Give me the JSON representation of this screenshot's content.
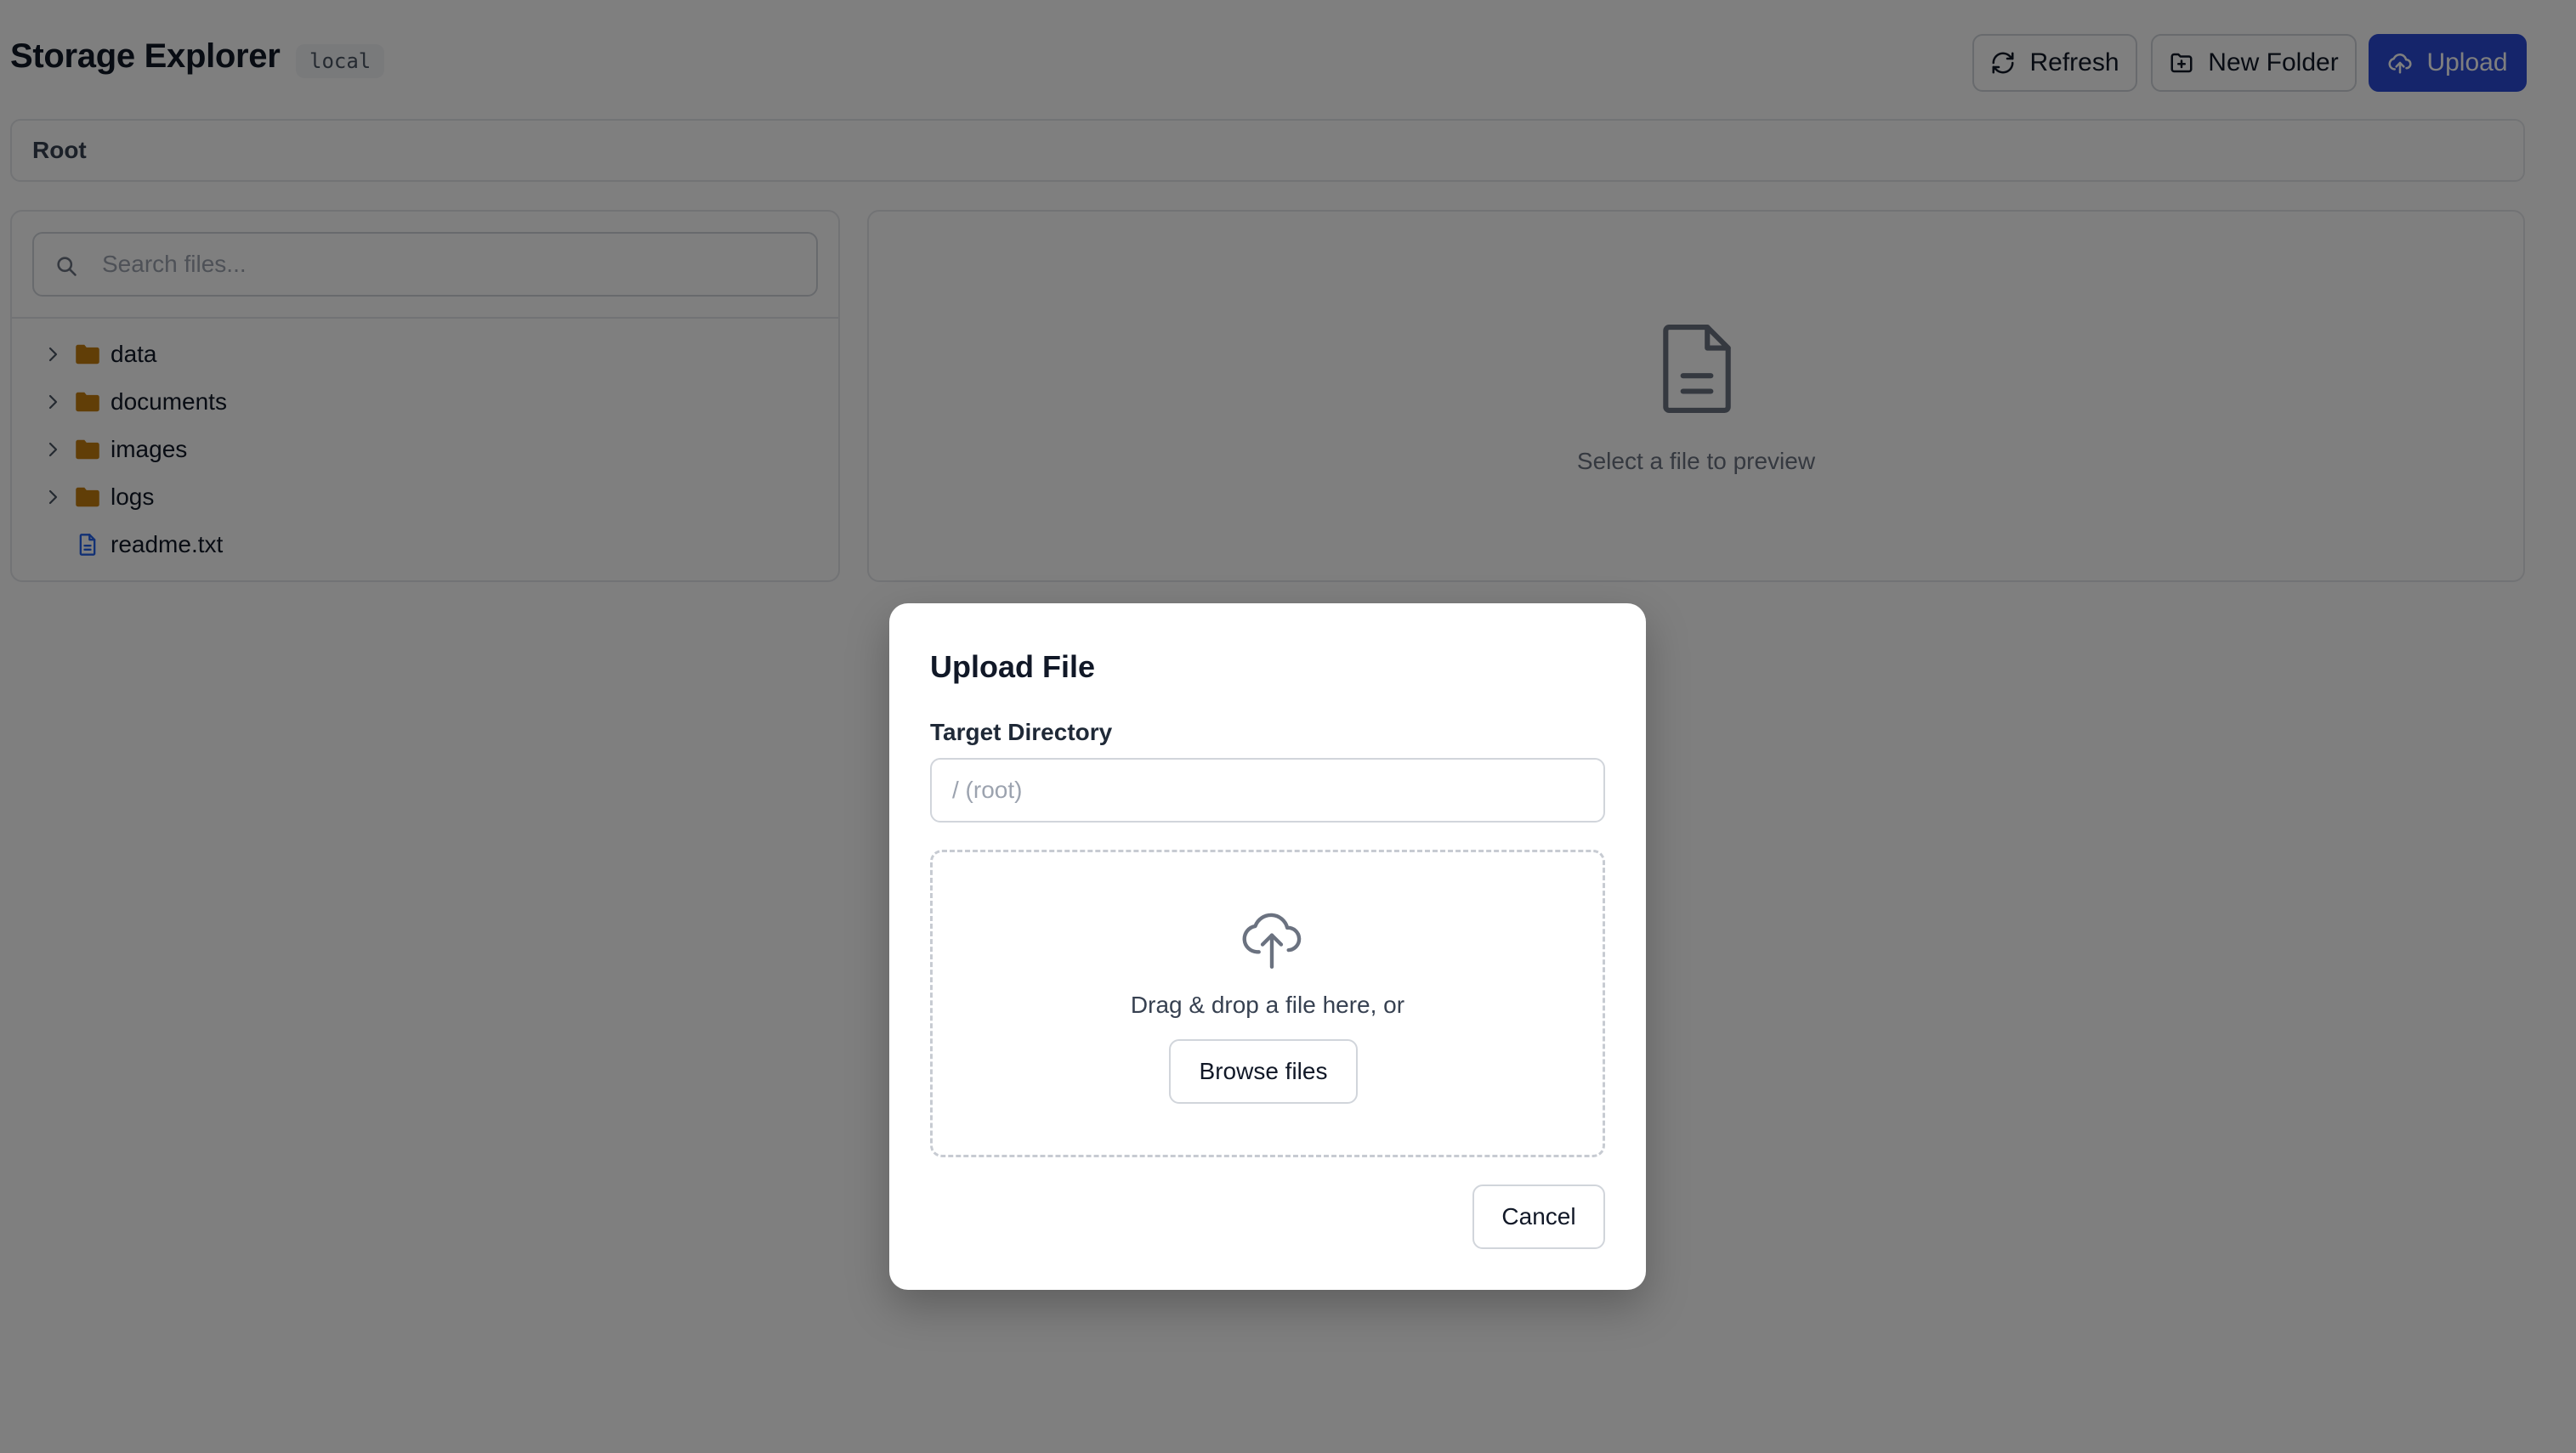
{
  "header": {
    "title": "Storage Explorer",
    "badge": "local",
    "refresh_label": "Refresh",
    "new_folder_label": "New Folder",
    "upload_label": "Upload"
  },
  "breadcrumb": {
    "root_label": "Root"
  },
  "tree": {
    "search_placeholder": "Search files...",
    "items": [
      {
        "label": "data",
        "type": "folder",
        "icon": "folder-icon"
      },
      {
        "label": "documents",
        "type": "folder",
        "icon": "folder-icon"
      },
      {
        "label": "images",
        "type": "folder",
        "icon": "folder-icon"
      },
      {
        "label": "logs",
        "type": "folder",
        "icon": "folder-icon"
      },
      {
        "label": "readme.txt",
        "type": "file",
        "icon": "file-icon"
      }
    ]
  },
  "preview": {
    "empty_text": "Select a file to preview",
    "icon": "file-text-icon"
  },
  "modal": {
    "title": "Upload File",
    "target_label": "Target Directory",
    "target_placeholder": "/ (root)",
    "target_value": "",
    "drop_text": "Drag & drop a file here, or",
    "browse_label": "Browse files",
    "cancel_label": "Cancel",
    "icon": "upload-cloud-icon"
  },
  "colors": {
    "primary": "#2b4bd6",
    "folder": "#c27c0e",
    "file": "#2563eb",
    "overlay": "rgba(0,0,0,0.5)"
  }
}
